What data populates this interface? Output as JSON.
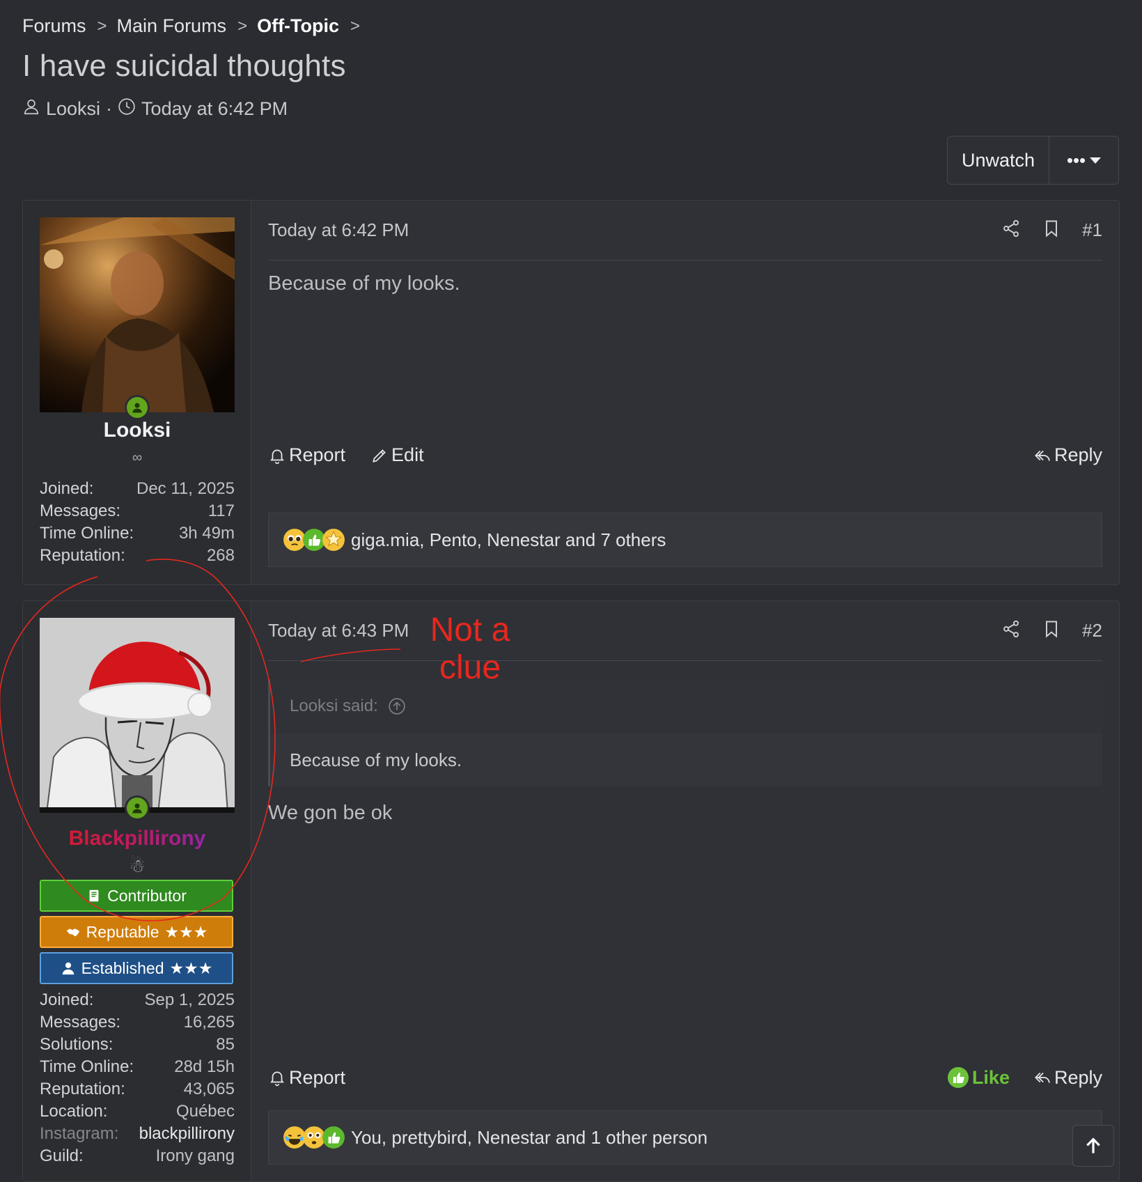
{
  "breadcrumb": {
    "items": [
      "Forums",
      "Main Forums",
      "Off-Topic"
    ],
    "separator": ">"
  },
  "thread": {
    "title": "I have suicidal thoughts",
    "author": "Looksi",
    "dot": "·",
    "time": "Today at 6:42 PM"
  },
  "top_actions": {
    "unwatch": "Unwatch",
    "more": "•••"
  },
  "posts": [
    {
      "username": "Looksi",
      "user_title": "∞",
      "stats": [
        {
          "k": "Joined:",
          "v": "Dec 11, 2025"
        },
        {
          "k": "Messages:",
          "v": "117"
        },
        {
          "k": "Time Online:",
          "v": "3h 49m"
        },
        {
          "k": "Reputation:",
          "v": "268"
        }
      ],
      "date": "Today at 6:42 PM",
      "number": "#1",
      "body": "Because of my looks.",
      "actions": {
        "report": "Report",
        "edit": "Edit",
        "reply": "Reply"
      },
      "reactions_text": "giga.mia, Pento, Nenestar and 7 others"
    },
    {
      "username": "Blackpillirony",
      "user_title": "☃",
      "banners": [
        {
          "label": "Contributor",
          "stars": ""
        },
        {
          "label": "Reputable",
          "stars": "★★★"
        },
        {
          "label": "Established",
          "stars": "★★★"
        }
      ],
      "stats": [
        {
          "k": "Joined:",
          "v": "Sep 1, 2025"
        },
        {
          "k": "Messages:",
          "v": "16,265"
        },
        {
          "k": "Solutions:",
          "v": "85"
        },
        {
          "k": "Time Online:",
          "v": "28d 15h"
        },
        {
          "k": "Reputation:",
          "v": "43,065"
        },
        {
          "k": "Location:",
          "v": "Québec"
        },
        {
          "k": "Instagram:",
          "v": "blackpillirony"
        },
        {
          "k": "Guild:",
          "v": "Irony gang"
        }
      ],
      "date": "Today at 6:43 PM",
      "number": "#2",
      "quote": {
        "author": "Looksi said:",
        "text": "Because of my looks."
      },
      "body": "We gon be ok",
      "actions": {
        "report": "Report",
        "like": "Like",
        "reply": "Reply"
      },
      "reactions_text": "You, prettybird, Nenestar and 1 other person"
    }
  ],
  "annotation": {
    "text": "Not a clue",
    "color": "#e8271e"
  },
  "colors": {
    "background": "#2a2c31",
    "online": "#63a51c",
    "like": "#6cc23a"
  }
}
